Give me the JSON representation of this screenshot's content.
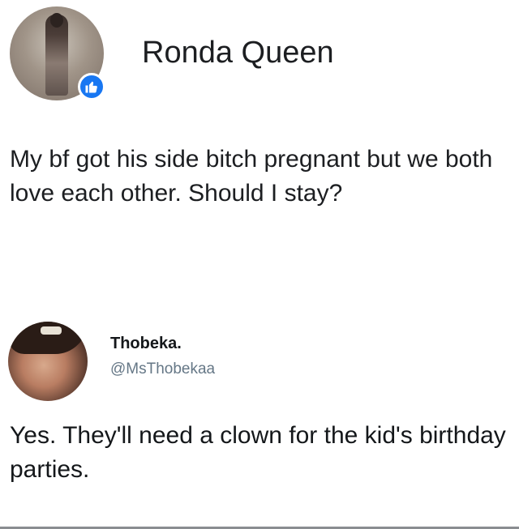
{
  "post": {
    "author_name": "Ronda Queen",
    "text": "My bf got his side bitch pregnant but we both love each other. Should I stay?",
    "badge_icon": "thumbs-up-icon",
    "badge_color": "#1877f2"
  },
  "reply": {
    "display_name": "Thobeka.",
    "handle": "@MsThobekaa",
    "text": "Yes. They'll need a clown for the kid's birthday parties."
  }
}
